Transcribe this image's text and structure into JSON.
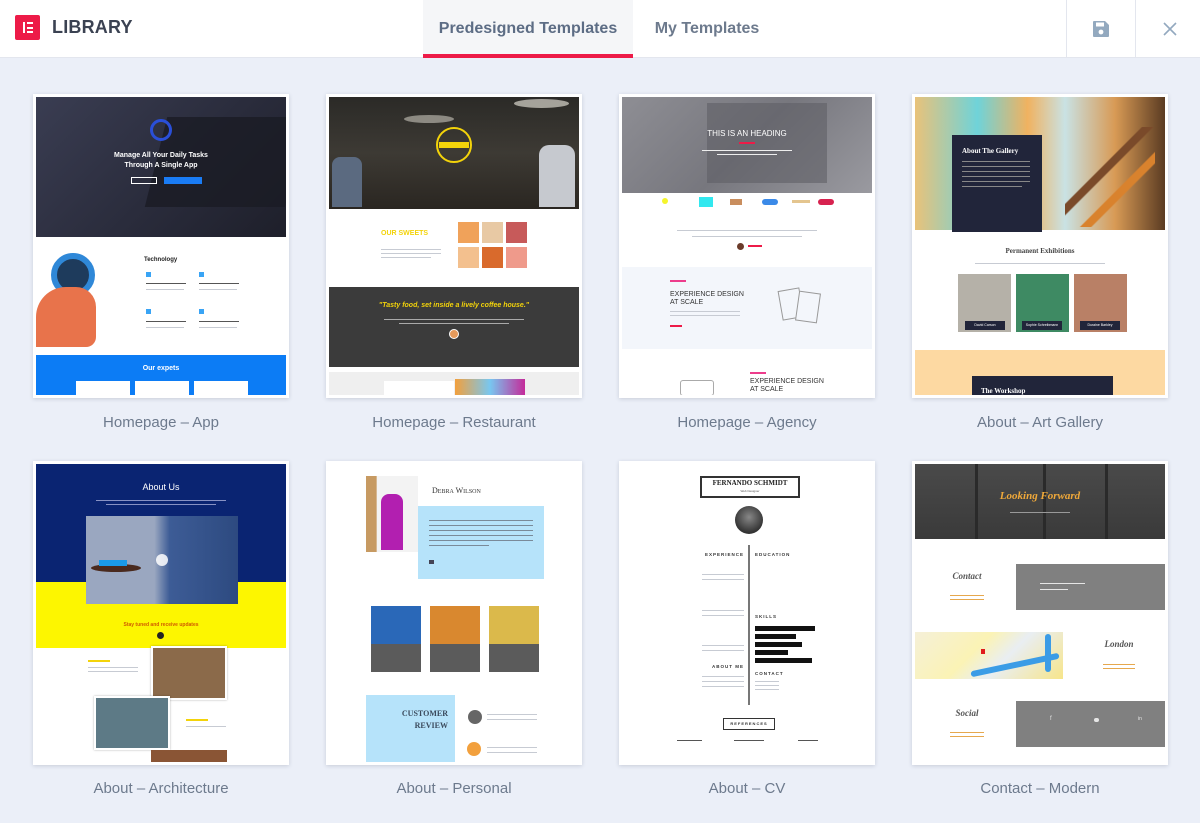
{
  "header": {
    "logo_icon": "elementor-logo-icon",
    "title": "LIBRARY",
    "tabs": [
      {
        "label": "Predesigned Templates",
        "active": true
      },
      {
        "label": "My Templates",
        "active": false
      }
    ],
    "save_icon": "floppy-disk-icon",
    "close_icon": "close-x-icon"
  },
  "colors": {
    "accent": "#ed1b48",
    "background": "#ebeff8",
    "label_text": "#6d7a8d"
  },
  "templates": [
    {
      "label": "Homepage – App",
      "preview": {
        "hero_title_1": "Manage All Your Daily Tasks",
        "hero_title_2": "Through A Single App",
        "section_title": "Technology",
        "band_title": "Our expets"
      }
    },
    {
      "label": "Homepage – Restaurant",
      "preview": {
        "section_title": "OUR SWEETS",
        "quote": "\"Tasty food, set inside a lively coffee house.\""
      }
    },
    {
      "label": "Homepage – Agency",
      "preview": {
        "hero_title": "THIS IS AN HEADING",
        "feature_title_1": "EXPERIENCE DESIGN",
        "feature_title_2": "AT SCALE"
      }
    },
    {
      "label": "About – Art Gallery",
      "preview": {
        "hero_title": "About The Gallery",
        "section_title": "Permanent Exhibitions",
        "artists": [
          "David Carson",
          "Sophie Schreibmann",
          "Duraine Barkley"
        ],
        "band_title": "The Workshop"
      }
    },
    {
      "label": "About – Architecture",
      "preview": {
        "hero_title": "About Us",
        "band_title": "Stay tuned and receive updates"
      }
    },
    {
      "label": "About – Personal",
      "preview": {
        "name": "Debra Wilson",
        "review_title_1": "CUSTOMER",
        "review_title_2": "REVIEW"
      }
    },
    {
      "label": "About – CV",
      "preview": {
        "name": "FERNANDO SCHMIDT",
        "subtitle": "Web Designer",
        "col_left": [
          "EXPERIENCE",
          "ABOUT ME"
        ],
        "col_right": [
          "EDUCATION",
          "SKILLS",
          "CONTACT"
        ],
        "references": "REFERENCES"
      }
    },
    {
      "label": "Contact – Modern",
      "preview": {
        "hero_title": "Looking Forward",
        "sections": [
          "Contact",
          "London",
          "Social"
        ]
      }
    }
  ]
}
